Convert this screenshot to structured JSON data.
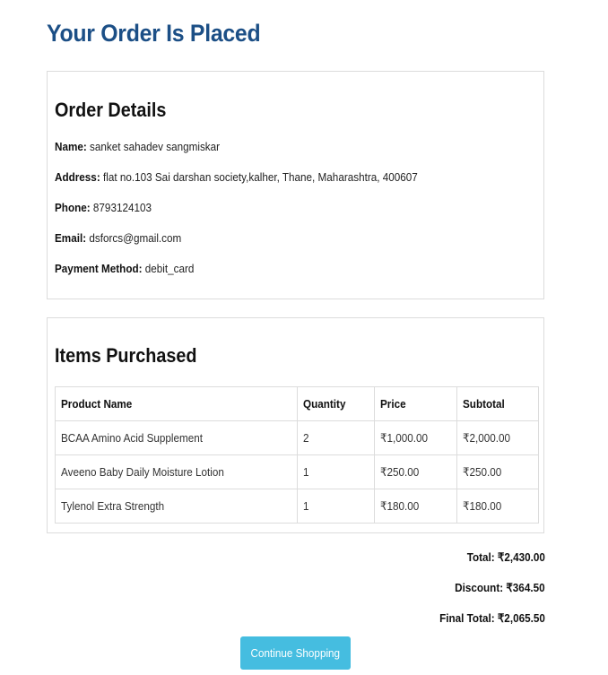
{
  "page": {
    "title": "Your Order Is Placed"
  },
  "order_details": {
    "heading": "Order Details",
    "name_label": "Name:",
    "name_value": "sanket sahadev sangmiskar",
    "address_label": "Address:",
    "address_value": "flat no.103 Sai darshan society,kalher, Thane, Maharashtra, 400607",
    "phone_label": "Phone:",
    "phone_value": "8793124103",
    "email_label": "Email:",
    "email_value": "dsforcs@gmail.com",
    "payment_label": "Payment Method:",
    "payment_value": "debit_card"
  },
  "items": {
    "heading": "Items Purchased",
    "columns": [
      "Product Name",
      "Quantity",
      "Price",
      "Subtotal"
    ],
    "rows": [
      {
        "product": "BCAA Amino Acid Supplement",
        "quantity": "2",
        "price": "₹1,000.00",
        "subtotal": "₹2,000.00"
      },
      {
        "product": "Aveeno Baby Daily Moisture Lotion",
        "quantity": "1",
        "price": "₹250.00",
        "subtotal": "₹250.00"
      },
      {
        "product": "Tylenol Extra Strength",
        "quantity": "1",
        "price": "₹180.00",
        "subtotal": "₹180.00"
      }
    ]
  },
  "totals": {
    "total": "Total: ₹2,430.00",
    "discount": "Discount: ₹364.50",
    "final_total": "Final Total: ₹2,065.50"
  },
  "actions": {
    "continue_label": "Continue Shopping"
  },
  "colors": {
    "title": "#1c4f86",
    "button": "#45bde0",
    "border": "#dcdcdc"
  }
}
